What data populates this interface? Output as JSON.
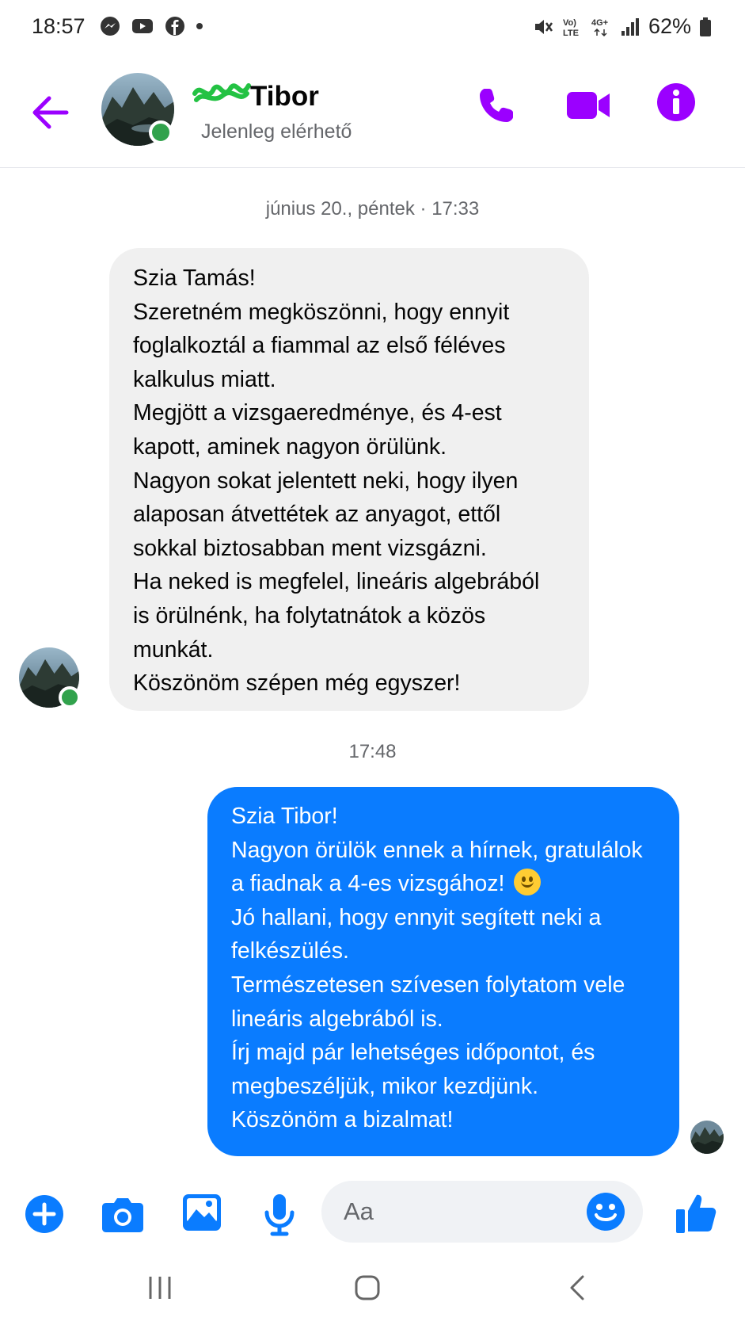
{
  "status_bar": {
    "time": "18:57",
    "left_icons": [
      "messenger-icon",
      "youtube-icon",
      "facebook-icon",
      "dot-icon"
    ],
    "right_icons": [
      "mute-icon",
      "volte-icon",
      "4g-icon",
      "signal-icon",
      "battery-icon"
    ],
    "volte_label": "Vo)\nLTE",
    "network_label": "4G+",
    "battery": "62%"
  },
  "header": {
    "contact_name": "Tibor",
    "status": "Jelenleg elérhető",
    "actions": [
      "phone-icon",
      "video-icon",
      "info-icon"
    ]
  },
  "conversation": {
    "timestamp_1": "június 20., péntek · 17:33",
    "incoming": {
      "lines": [
        "Szia Tamás!",
        "Szeretném megköszönni, hogy ennyit",
        "foglalkoztál a fiammal az első féléves",
        "kalkulus miatt.",
        "Megjött a vizsgaeredménye, és 4-est",
        "kapott, aminek nagyon örülünk.",
        "Nagyon sokat jelentett neki, hogy ilyen",
        "alaposan átvettétek az anyagot, ettől",
        "sokkal biztosabban ment vizsgázni.",
        "Ha neked is megfelel, lineáris algebrából",
        "is örülnénk, ha folytatnátok a közös",
        "munkát.",
        "Köszönöm szépen még egyszer!"
      ]
    },
    "timestamp_2": "17:48",
    "outgoing": {
      "lines": [
        "Szia Tibor!",
        "Nagyon örülök ennek a hírnek, gratulálok",
        "a fiadnak a 4-es vizsgához!",
        "Jó hallani, hogy ennyit segített neki a",
        "felkészülés.",
        "Természetesen szívesen folytatom vele",
        "lineáris algebrából is.",
        "Írj majd pár lehetséges időpontot, és",
        "megbeszéljük, mikor kezdjünk.",
        "Köszönöm a bizalmat!"
      ],
      "emoji": "slightly-smiling-face"
    }
  },
  "composer": {
    "placeholder": "Aa",
    "buttons": [
      "plus-icon",
      "camera-icon",
      "gallery-icon",
      "microphone-icon",
      "emoji-icon",
      "thumbs-up-icon"
    ]
  },
  "colors": {
    "accent_purple": "#9b00ff",
    "messenger_blue": "#0a7cff",
    "online_green": "#31a24c",
    "incoming_bubble": "#f0f0f0"
  }
}
